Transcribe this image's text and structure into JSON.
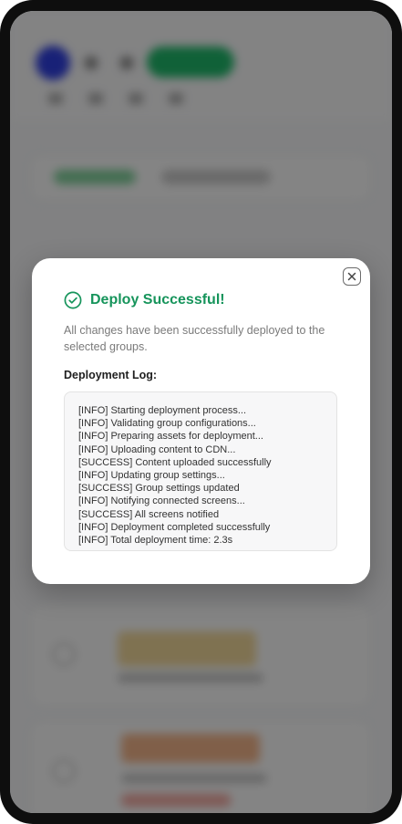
{
  "colors": {
    "success": "#16945b",
    "overlay": "rgba(0,0,0,0.47)",
    "log_background": "#f7f7f8"
  },
  "icons": {
    "close": "close-icon",
    "success": "check-circle-icon"
  },
  "modal": {
    "title": "Deploy Successful!",
    "description": "All changes have been successfully deployed to the selected groups.",
    "log_label": "Deployment Log:",
    "log_lines": [
      "[INFO] Starting deployment process...",
      "[INFO] Validating group configurations...",
      "[INFO] Preparing assets for deployment...",
      "[INFO] Uploading content to CDN...",
      "[SUCCESS] Content uploaded successfully",
      "[INFO] Updating group settings...",
      "[SUCCESS] Group settings updated",
      "[INFO] Notifying connected screens...",
      "[SUCCESS] All screens notified",
      "[INFO] Deployment completed successfully",
      "[INFO] Total deployment time: 2.3s"
    ]
  }
}
